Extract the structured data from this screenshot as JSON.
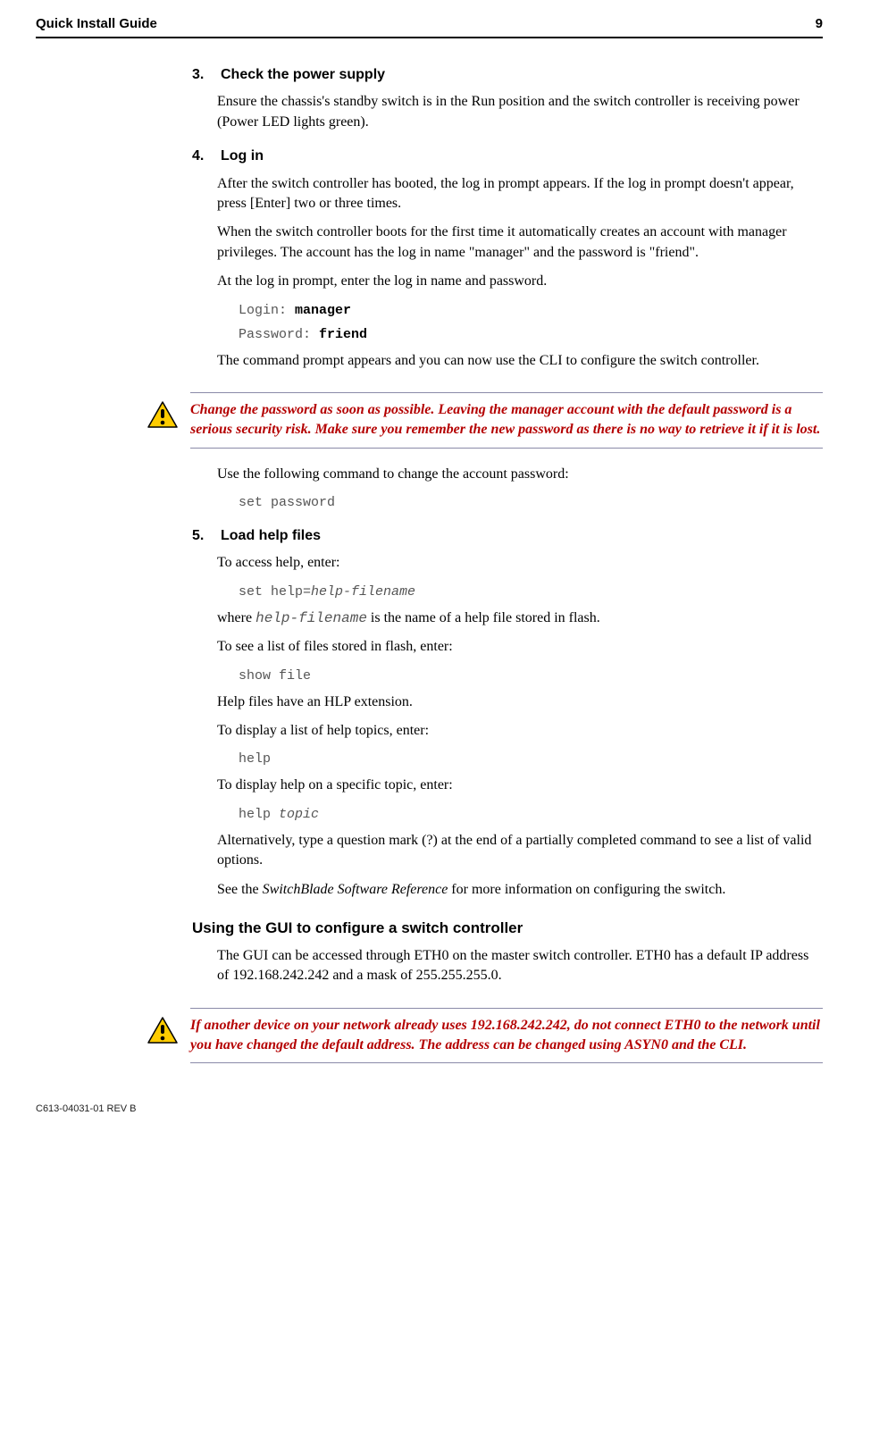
{
  "header": {
    "title": "Quick Install Guide",
    "page": "9"
  },
  "step3": {
    "num": "3.",
    "title": "Check the power supply",
    "p1": "Ensure the chassis's standby switch is in the Run position and the switch controller is receiving power (Power LED lights green)."
  },
  "step4": {
    "num": "4.",
    "title": "Log in",
    "p1": "After the switch controller has booted, the log in prompt appears. If the log in prompt doesn't appear, press [Enter] two or three times.",
    "p2": "When the switch controller boots for the first time it automatically creates an account with manager privileges. The account has the log in name \"manager\" and the password is \"friend\".",
    "p3": "At the log in prompt, enter the log in name and password.",
    "login_label": "Login: ",
    "login_value": "manager",
    "password_label": "Password: ",
    "password_value": "friend",
    "p4": "The command prompt appears and you can now use the CLI to configure the switch controller."
  },
  "warn1": "Change the password as soon as possible. Leaving the manager account with the default password is a serious security risk. Make sure you remember the new password as there is no way to retrieve it if it is lost.",
  "post_warn1": {
    "p1": "Use the following command to change the account password:",
    "cmd": "set password"
  },
  "step5": {
    "num": "5.",
    "title": "Load help files",
    "p1": "To access help, enter:",
    "cmd1a": "set help=",
    "cmd1b": "help-filename",
    "p2a": "where ",
    "p2b": "help-filename",
    "p2c": " is the name of a help file stored in flash.",
    "p3": "To see a list of files stored in flash, enter:",
    "cmd2": "show file",
    "p4": "Help files have an HLP extension.",
    "p5": "To display a list of help topics, enter:",
    "cmd3": "help",
    "p6": "To display help on a specific topic, enter:",
    "cmd4a": "help ",
    "cmd4b": "topic",
    "p7": "Alternatively, type a question mark (?) at the end of a partially completed command to see a list of valid options.",
    "p8a": "See the ",
    "p8b": "SwitchBlade Software Reference",
    "p8c": " for more information on configuring the switch."
  },
  "gui_heading": "Using the GUI to configure a switch controller",
  "gui_p1": "The GUI can be accessed through ETH0 on the master switch controller. ETH0 has a default IP address of 192.168.242.242 and a mask of 255.255.255.0.",
  "warn2": "If another device on your network already uses 192.168.242.242, do not connect ETH0 to the network until you have changed the default address. The address can be changed using ASYN0 and the CLI.",
  "footer": "C613-04031-01 REV B"
}
